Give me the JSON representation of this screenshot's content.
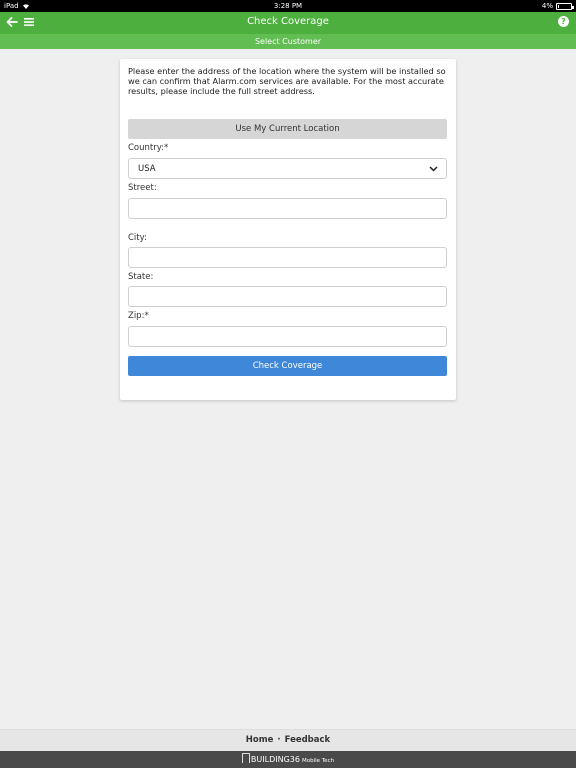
{
  "status_bar": {
    "device": "iPad",
    "time": "3:28 PM",
    "battery": "4%",
    "battery_level": 0.04
  },
  "header": {
    "title": "Check Coverage",
    "subtitle": "Select Customer",
    "help_symbol": "?"
  },
  "form": {
    "intro": "Please enter the address of the location where the system will be installed so we can confirm that Alarm.com services are available. For the most accurate results, please include the full street address.",
    "location_button": "Use My Current Location",
    "country_label": "Country:*",
    "country_value": "USA",
    "street_label": "Street:",
    "street_value": "",
    "city_label": "City:",
    "city_value": "",
    "state_label": "State:",
    "state_value": "",
    "zip_label": "Zip:*",
    "zip_value": "",
    "submit_button": "Check Coverage"
  },
  "footer": {
    "home": "Home",
    "separator": "·",
    "feedback": "Feedback",
    "brand": "BUILDING36",
    "tagline": "Mobile Tech"
  },
  "colors": {
    "header": "#4caf3e",
    "subheader": "#62bd52",
    "primary_button": "#3f87d9",
    "background": "#efefef"
  }
}
